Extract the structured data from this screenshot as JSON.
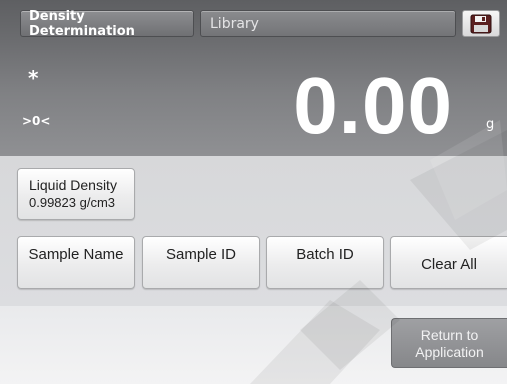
{
  "header": {
    "mode_tab": "Density Determination",
    "library_tab": "Library",
    "save_icon": "floppy-disk-icon"
  },
  "display": {
    "stability_indicator": "*",
    "center_of_zero": ">0<",
    "weight": "0.00",
    "unit": "g"
  },
  "liquid_density": {
    "label": "Liquid Density",
    "value": "0.99823 g/cm3"
  },
  "buttons": {
    "sample_name": "Sample Name",
    "sample_id": "Sample ID",
    "batch_id": "Batch ID",
    "clear_all": "Clear All",
    "return_line1": "Return to",
    "return_line2": "Application"
  },
  "colors": {
    "display_bg": "#6b6c6f",
    "panel_bg": "#d9dadc",
    "button_bg": "#f2f2f3",
    "return_bg": "#919295"
  }
}
